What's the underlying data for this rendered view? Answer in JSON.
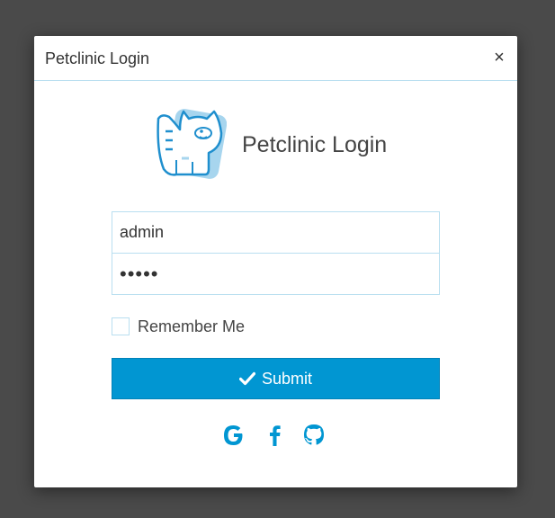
{
  "dialog": {
    "title": "Petclinic Login",
    "close_glyph": "×"
  },
  "logo": {
    "icon_name": "cat-mascot-icon",
    "title": "Petclinic Login"
  },
  "form": {
    "username": {
      "value": "admin"
    },
    "password": {
      "value": "•••••"
    },
    "remember_me": {
      "label": "Remember Me",
      "checked": false
    },
    "submit": {
      "label": "Submit",
      "icon": "check-icon"
    }
  },
  "social": {
    "icons": [
      "google-icon",
      "facebook-icon",
      "github-icon"
    ]
  },
  "colors": {
    "accent": "#0196d2",
    "border": "#b9dff0",
    "backdrop": "#4a4a4a",
    "logo_light": "#a7d5ee"
  }
}
